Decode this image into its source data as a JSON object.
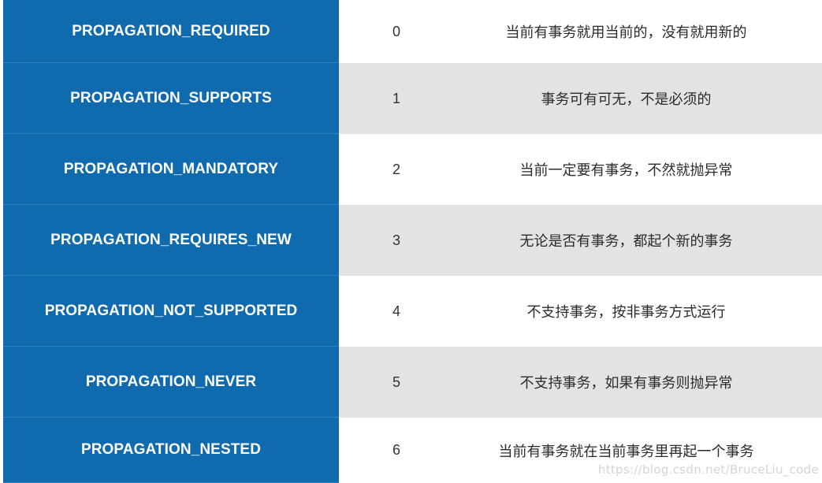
{
  "rows": [
    {
      "name": "PROPAGATION_REQUIRED",
      "value": "0",
      "description": "当前有事务就用当前的，没有就用新的"
    },
    {
      "name": "PROPAGATION_SUPPORTS",
      "value": "1",
      "description": "事务可有可无，不是必须的"
    },
    {
      "name": "PROPAGATION_MANDATORY",
      "value": "2",
      "description": "当前一定要有事务，不然就抛异常"
    },
    {
      "name": "PROPAGATION_REQUIRES_NEW",
      "value": "3",
      "description": "无论是否有事务，都起个新的事务"
    },
    {
      "name": "PROPAGATION_NOT_SUPPORTED",
      "value": "4",
      "description": "不支持事务，按非事务方式运行"
    },
    {
      "name": "PROPAGATION_NEVER",
      "value": "5",
      "description": "不支持事务，如果有事务则抛异常"
    },
    {
      "name": "PROPAGATION_NESTED",
      "value": "6",
      "description": "当前有事务就在当前事务里再起一个事务"
    }
  ],
  "watermark": "https://blog.csdn.net/BruceLiu_code",
  "colors": {
    "name_column_bg": "#0f6bad",
    "row_alt_bg": "#e3e3e5"
  }
}
